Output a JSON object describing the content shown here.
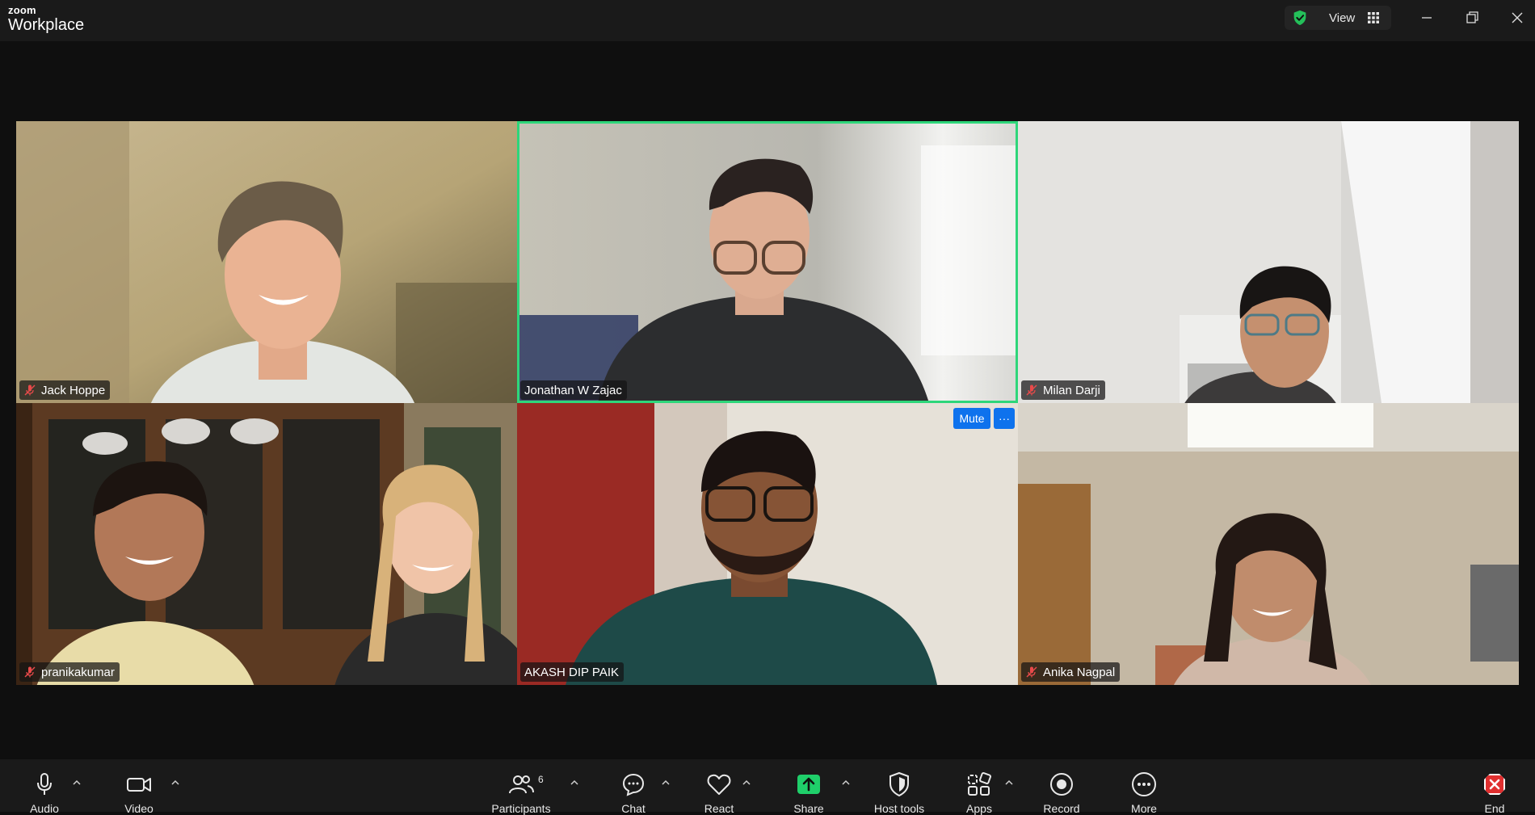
{
  "app": {
    "brand_top": "zoom",
    "brand_bottom": "Workplace",
    "view_label": "View",
    "accent_color": "#2ed67a",
    "button_blue": "#0e72ed"
  },
  "participants": [
    {
      "name": "Jack Hoppe",
      "muted": true
    },
    {
      "name": "Jonathan W Zajac",
      "muted": false,
      "active_speaker": true
    },
    {
      "name": "Milan Darji",
      "muted": true
    },
    {
      "name": "pranikakumar",
      "muted": true
    },
    {
      "name": "AKASH DIP PAIK",
      "muted": false
    },
    {
      "name": "Anika Nagpal",
      "muted": true
    }
  ],
  "tile_controls": {
    "mute_label": "Mute",
    "more_label": "···"
  },
  "toolbar": {
    "audio": "Audio",
    "video": "Video",
    "participants": "Participants",
    "participants_count": "6",
    "chat": "Chat",
    "react": "React",
    "share": "Share",
    "host_tools": "Host tools",
    "apps": "Apps",
    "record": "Record",
    "more": "More",
    "end": "End"
  }
}
